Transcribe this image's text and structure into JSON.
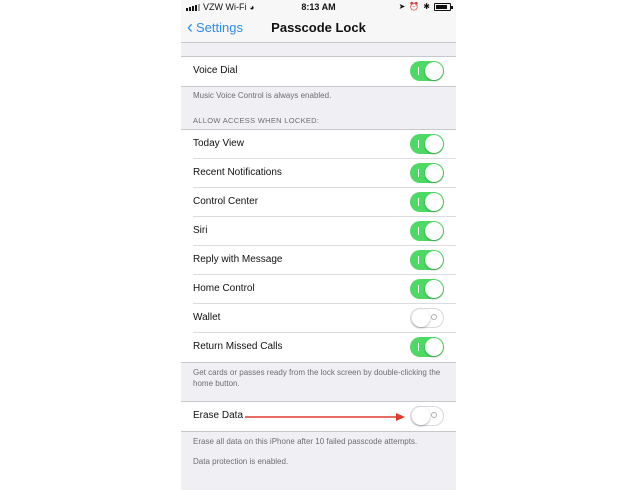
{
  "status": {
    "carrier": "VZW Wi-Fi",
    "time": "8:13 AM"
  },
  "nav": {
    "back_label": "Settings",
    "title": "Passcode Lock"
  },
  "voice_dial": {
    "label": "Voice Dial",
    "on": true,
    "note": "Music Voice Control is always enabled."
  },
  "allow_access": {
    "header": "ALLOW ACCESS WHEN LOCKED:",
    "items": [
      {
        "label": "Today View",
        "on": true
      },
      {
        "label": "Recent Notifications",
        "on": true
      },
      {
        "label": "Control Center",
        "on": true
      },
      {
        "label": "Siri",
        "on": true
      },
      {
        "label": "Reply with Message",
        "on": true
      },
      {
        "label": "Home Control",
        "on": true
      },
      {
        "label": "Wallet",
        "on": false
      },
      {
        "label": "Return Missed Calls",
        "on": true
      }
    ],
    "note": "Get cards or passes ready from the lock screen by double-clicking the home button."
  },
  "erase_data": {
    "label": "Erase Data",
    "on": false,
    "note1": "Erase all data on this iPhone after 10 failed passcode attempts.",
    "note2": "Data protection is enabled."
  },
  "colors": {
    "accent": "#2d8cf0",
    "toggle_on": "#4cd964",
    "arrow": "#e03a2f"
  }
}
